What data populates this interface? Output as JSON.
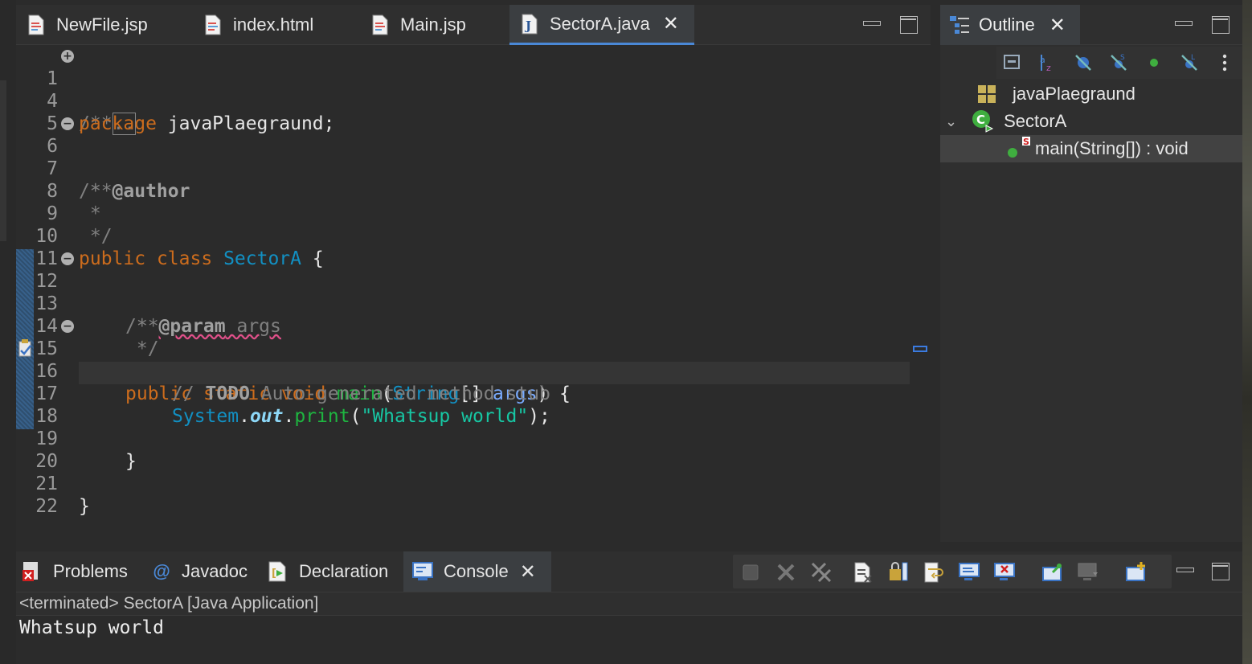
{
  "editor": {
    "tabs": [
      {
        "label": "NewFile.jsp",
        "icon": "jsp-file-icon"
      },
      {
        "label": "index.html",
        "icon": "html-file-icon"
      },
      {
        "label": "Main.jsp",
        "icon": "jsp-file-icon"
      },
      {
        "label": "SectorA.java",
        "icon": "java-file-icon",
        "active": true
      }
    ],
    "close_glyph": "✕",
    "lines": [
      {
        "n": "1",
        "fold": "+"
      },
      {
        "n": "4"
      },
      {
        "n": "5"
      },
      {
        "n": "6",
        "fold": "−"
      },
      {
        "n": "7"
      },
      {
        "n": "8"
      },
      {
        "n": "9"
      },
      {
        "n": "10"
      },
      {
        "n": "11"
      },
      {
        "n": "12",
        "fold": "−"
      },
      {
        "n": "13"
      },
      {
        "n": "14"
      },
      {
        "n": "15",
        "fold": "−"
      },
      {
        "n": "16"
      },
      {
        "n": "17"
      },
      {
        "n": "18"
      },
      {
        "n": "19"
      },
      {
        "n": "20"
      },
      {
        "n": "21"
      },
      {
        "n": "22"
      }
    ],
    "code": {
      "l1": "/**",
      "l1_collapsed": "..",
      "l4_kw": "package",
      "l4_rest": " javaPlaegraund;",
      "l6": "/**",
      "l7_star": " * ",
      "l7_tag": "@author",
      "l8": " *",
      "l9": " */",
      "l10_kw1": "public",
      "l10_kw2": "class",
      "l10_name": "SectorA",
      "l10_brace": " {",
      "l12": "/**",
      "l13_star": " * ",
      "l13_tag": "@param",
      "l13_arg": " args",
      "l14": " */",
      "l15_kw1": "public",
      "l15_kw2": "static",
      "l15_kw3": "void",
      "l15_method": "main",
      "l15_p1": "(",
      "l15_type": "String",
      "l15_p2": "[] ",
      "l15_param": "args",
      "l15_p3": ") {",
      "l16_slash": "// ",
      "l16_todo": "TODO",
      "l16_rest": " Auto-generated method stub",
      "l17_sys": "System",
      "l17_dot1": ".",
      "l17_out": "out",
      "l17_dot2": ".",
      "l17_print": "print",
      "l17_p1": "(",
      "l17_str": "\"Whatsup world\"",
      "l17_p2": ");",
      "l19": "}",
      "l21": "}"
    }
  },
  "outline": {
    "tab_label": "Outline",
    "close_glyph": "✕",
    "toolbar": [
      "collapse-all-icon",
      "sort-alpha-icon",
      "hide-fields-icon",
      "hide-static-icon",
      "public-member-icon",
      "hide-nonpublic-icon",
      "more-menu-icon"
    ],
    "tree": [
      {
        "label": "javaPlaegraund",
        "icon": "package-icon"
      },
      {
        "label": "SectorA",
        "icon": "class-icon",
        "expanded": true
      },
      {
        "label": "main(String[]) : void",
        "icon": "method-icon",
        "badge": "S",
        "selected": true
      }
    ]
  },
  "console": {
    "tabs": [
      {
        "label": "Problems",
        "icon": "problems-icon"
      },
      {
        "label": "Javadoc",
        "icon": "javadoc-icon"
      },
      {
        "label": "Declaration",
        "icon": "declaration-icon"
      },
      {
        "label": "Console",
        "icon": "console-icon",
        "active": true
      }
    ],
    "close_glyph": "✕",
    "status": "<terminated> SectorA [Java Application]",
    "output": "Whatsup world",
    "toolbar": [
      "terminate-icon",
      "remove-launch-icon",
      "remove-all-icon",
      "clear-console-icon",
      "scroll-lock-icon",
      "word-wrap-icon",
      "show-stdout-icon",
      "show-stderr-icon",
      "pin-console-icon",
      "display-console-icon",
      "open-console-icon"
    ]
  },
  "colors": {
    "keyword": "#cc6c1d",
    "type": "#1290c3",
    "method": "#1eb540",
    "string": "#17c6a3",
    "comment": "#808080",
    "accent": "#4a88d6"
  }
}
